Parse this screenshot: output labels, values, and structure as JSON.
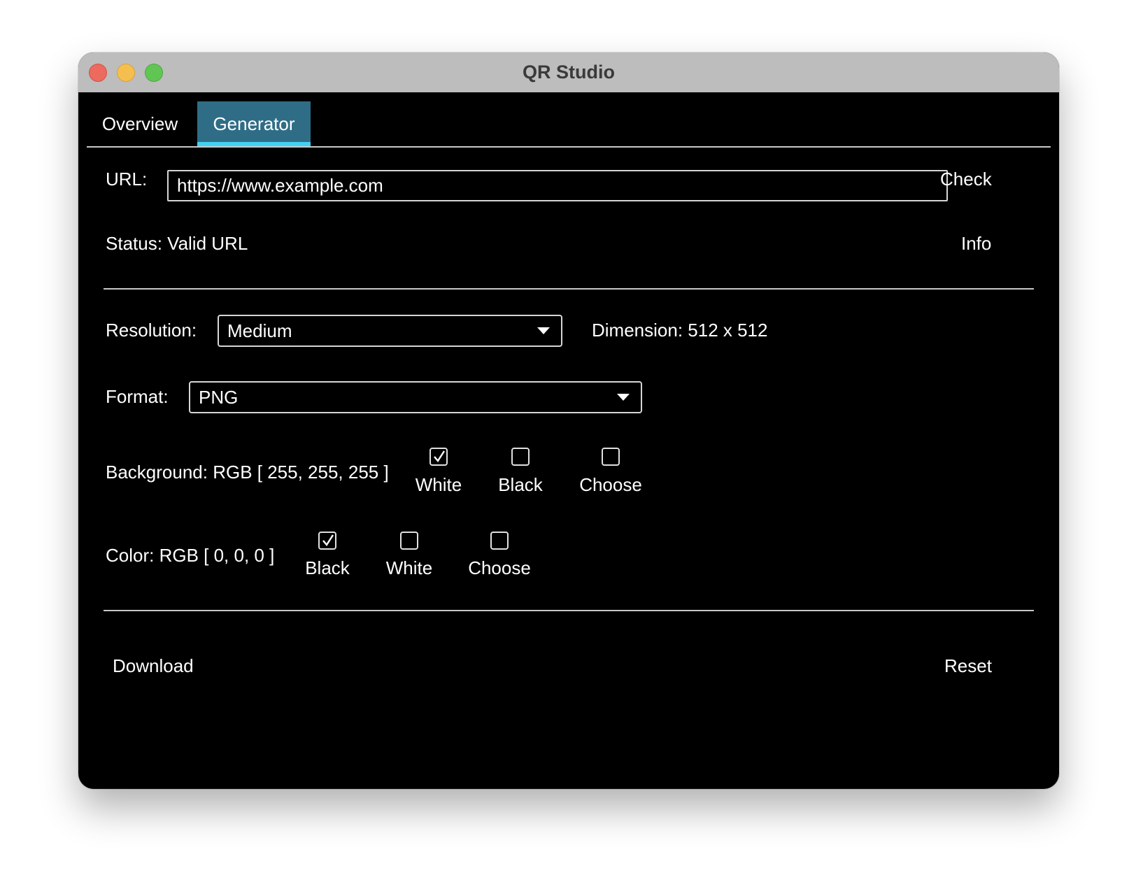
{
  "window": {
    "title": "QR Studio"
  },
  "tabs": [
    {
      "label": "Overview",
      "active": false
    },
    {
      "label": "Generator",
      "active": true
    }
  ],
  "url": {
    "label": "URL:",
    "value": "https://www.example.com",
    "check_label": "Check"
  },
  "status": {
    "text": "Status: Valid URL",
    "info_label": "Info"
  },
  "resolution": {
    "label": "Resolution:",
    "selected": "Medium",
    "dimension": "Dimension: 512 x 512"
  },
  "format": {
    "label": "Format:",
    "selected": "PNG"
  },
  "background": {
    "label": "Background: RGB [ 255, 255, 255 ]",
    "options": [
      {
        "label": "White",
        "checked": true
      },
      {
        "label": "Black",
        "checked": false
      },
      {
        "label": "Choose",
        "checked": false
      }
    ]
  },
  "color": {
    "label": "Color: RGB [ 0, 0, 0 ]",
    "options": [
      {
        "label": "Black",
        "checked": true
      },
      {
        "label": "White",
        "checked": false
      },
      {
        "label": "Choose",
        "checked": false
      }
    ]
  },
  "actions": {
    "download_label": "Download",
    "reset_label": "Reset"
  },
  "colors": {
    "active_tab": "#2f6d86",
    "tab_underline": "#43d1f3",
    "window_bg": "#000000",
    "titlebar": "#bdbdbd"
  }
}
